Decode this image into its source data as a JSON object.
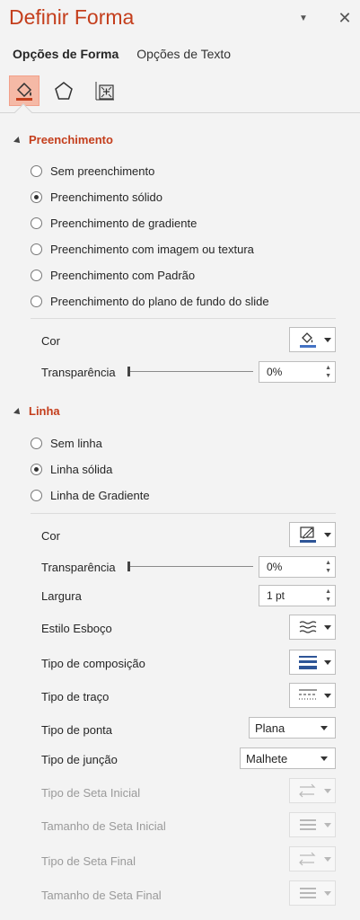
{
  "header": {
    "title": "Definir Forma"
  },
  "tabs": [
    {
      "label": "Opções de Forma"
    },
    {
      "label": "Opções de Texto"
    }
  ],
  "colors": {
    "accent": "#c43e1c",
    "fill_color": "#4472c4",
    "line_color": "#2e5597"
  },
  "fill": {
    "title": "Preenchimento",
    "options": [
      {
        "label": "Sem preenchimento",
        "selected": false
      },
      {
        "label": "Preenchimento sólido",
        "selected": true
      },
      {
        "label": "Preenchimento de gradiente",
        "selected": false
      },
      {
        "label": "Preenchimento com imagem ou textura",
        "selected": false
      },
      {
        "label": "Preenchimento com Padrão",
        "selected": false
      },
      {
        "label": "Preenchimento do plano de fundo do slide",
        "selected": false
      }
    ],
    "color_label": "Cor",
    "transparency_label": "Transparência",
    "transparency_value": "0%"
  },
  "line": {
    "title": "Linha",
    "options": [
      {
        "label": "Sem linha",
        "selected": false
      },
      {
        "label": "Linha sólida",
        "selected": true
      },
      {
        "label": "Linha de Gradiente",
        "selected": false
      }
    ],
    "color_label": "Cor",
    "transparency_label": "Transparência",
    "transparency_value": "0%",
    "width_label": "Largura",
    "width_value": "1 pt",
    "sketch_label": "Estilo Esboço",
    "compound_label": "Tipo de composição",
    "dash_label": "Tipo de traço",
    "cap_label": "Tipo de ponta",
    "cap_value": "Plana",
    "join_label": "Tipo de junção",
    "join_value": "Malhete",
    "begin_arrow_type_label": "Tipo de Seta Inicial",
    "begin_arrow_size_label": "Tamanho de Seta Inicial",
    "end_arrow_type_label": "Tipo de Seta Final",
    "end_arrow_size_label": "Tamanho de Seta Final"
  }
}
